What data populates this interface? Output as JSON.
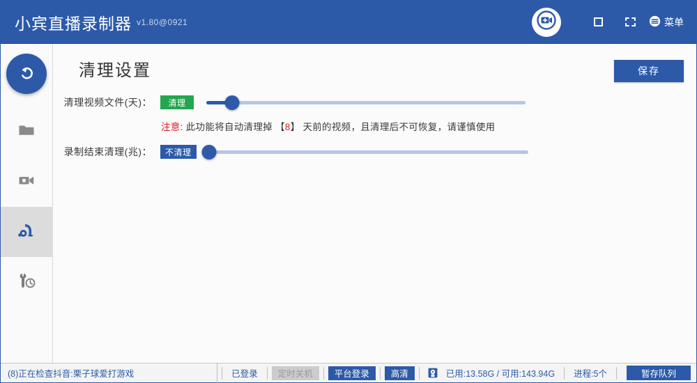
{
  "titlebar": {
    "app_title": "小宾直播录制器",
    "version": "v1.80@0921",
    "menu_label": "菜单",
    "icons": {
      "add_record": "add-video-circle-icon",
      "maximize": "square-icon",
      "folder": "dashed-folder-icon",
      "menu": "hamburger-circle-icon"
    },
    "bg_color": "#2c5aa8"
  },
  "sidebar": {
    "items": [
      {
        "name": "back",
        "icon": "back-arrow-icon",
        "selected": false
      },
      {
        "name": "folder",
        "icon": "folder-icon",
        "selected": false
      },
      {
        "name": "recordings",
        "icon": "video-camera-icon",
        "selected": false
      },
      {
        "name": "cleanup",
        "icon": "vacuum-cleaner-icon",
        "selected": true
      },
      {
        "name": "tools-schedule",
        "icon": "wrench-clock-icon",
        "selected": false
      }
    ],
    "selected_color": "#dcdcdc",
    "accent_color": "#2c5aa8"
  },
  "main": {
    "page_title": "清理设置",
    "save_label": "保存",
    "rows": [
      {
        "label": "清理视频文件(天)：",
        "badge": "清理",
        "badge_color": "#22a74f",
        "slider_percent": 8
      },
      {
        "label": "录制结束清理(兆)：",
        "badge": "不清理",
        "badge_color": "#2c5aa8",
        "slider_percent": 0
      }
    ],
    "warning": {
      "prefix": "注意",
      "colon": ": ",
      "text_1": "此功能将自动清理掉 【",
      "days": "8",
      "text_2": "】 天前的视频，且清理后不可恢复，请谨慎使用",
      "highlight_color": "#e02020"
    }
  },
  "statusbar": {
    "message": "(8)正在检查抖音:栗子球爱打游戏",
    "logged_in": "已登录",
    "scheduled_shutdown": "定时关机",
    "platform_login": "平台登录",
    "quality": "高清",
    "disk_icon": "disk-drive-icon",
    "storage": "已用:13.58G / 可用:143.94G",
    "processes": "进程:5个",
    "queue_button": "暂存队列"
  }
}
